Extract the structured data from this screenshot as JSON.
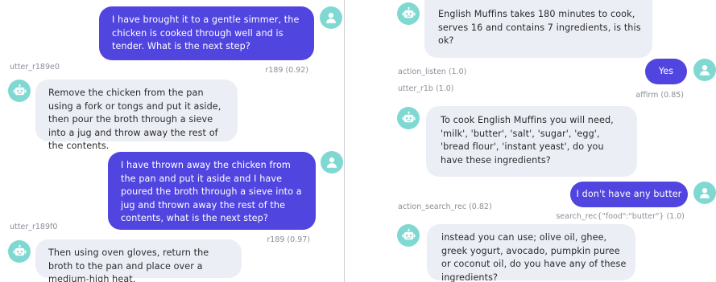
{
  "left": {
    "u1": "I have brought it to a gentle simmer, the chicken is cooked through well and is tender. What is the next step?",
    "u1_intent": "r189 (0.92)",
    "b1_action": "utter_r189e0",
    "b1": "Remove the chicken from the pan using a fork or tongs and put it aside, then pour the broth through a sieve into a jug and throw away the rest of the contents.",
    "u2": "I have thrown away the chicken from the pan and put it aside and I have poured the broth through a sieve into a jug and thrown away the rest of the contents, what is the next step?",
    "u2_intent": "r189 (0.97)",
    "b2_action": "utter_r189f0",
    "b2": "Then using oven gloves, return the broth to the pan and place over a medium-high heat."
  },
  "right": {
    "b1": "English Muffins takes 180 minutes to cook, serves 16 and contains 7 ingredients, is this ok?",
    "a1": "action_listen (1.0)",
    "u1": "Yes",
    "u1_intent": "affirm (0.85)",
    "a2": "utter_r1b (1.0)",
    "b2": "To cook English Muffins you will need, 'milk', 'butter', 'salt', 'sugar', 'egg', 'bread flour', 'instant yeast', do you have these ingredients?",
    "u2": "I don't have any butter",
    "a3": "action_search_rec (0.82)",
    "u2_intent": "search_rec{\"food\":\"butter\"} (1.0)",
    "b3": "instead you can use; olive oil, ghee, greek yogurt, avocado, pumpkin puree or coconut oil, do you have any of these ingredients?"
  },
  "icons": {
    "bot": "robot-icon",
    "user": "user-icon"
  },
  "colors": {
    "user_bubble": "#5145e0",
    "bot_bubble": "#eceef6",
    "avatar": "#7fd9d2"
  }
}
